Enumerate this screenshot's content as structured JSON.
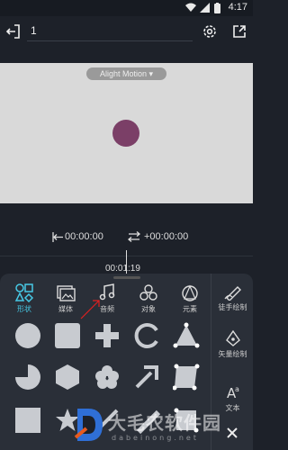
{
  "status": {
    "time": "4:17"
  },
  "header": {
    "project_title": "1"
  },
  "canvas": {
    "watermark_label": "Alight Motion ▾"
  },
  "time": {
    "start": "00:00:00",
    "offset": "+00:00:00",
    "current": "00:01:19"
  },
  "categories": [
    {
      "label": "形状"
    },
    {
      "label": "媒体"
    },
    {
      "label": "音频"
    },
    {
      "label": "对象"
    },
    {
      "label": "元素"
    }
  ],
  "side_tools": [
    {
      "label": "徒手绘制"
    },
    {
      "label": "矢量绘制"
    },
    {
      "label": "文本"
    }
  ],
  "watermark": {
    "name": "大毛农软件园",
    "url": "dabeinong.net"
  },
  "colors": {
    "accent": "#47c9e5",
    "canvas_bg": "#d9d9d9",
    "circle": "#7b3f67",
    "panel": "#2a2f38",
    "app_bg": "#1d2129"
  }
}
